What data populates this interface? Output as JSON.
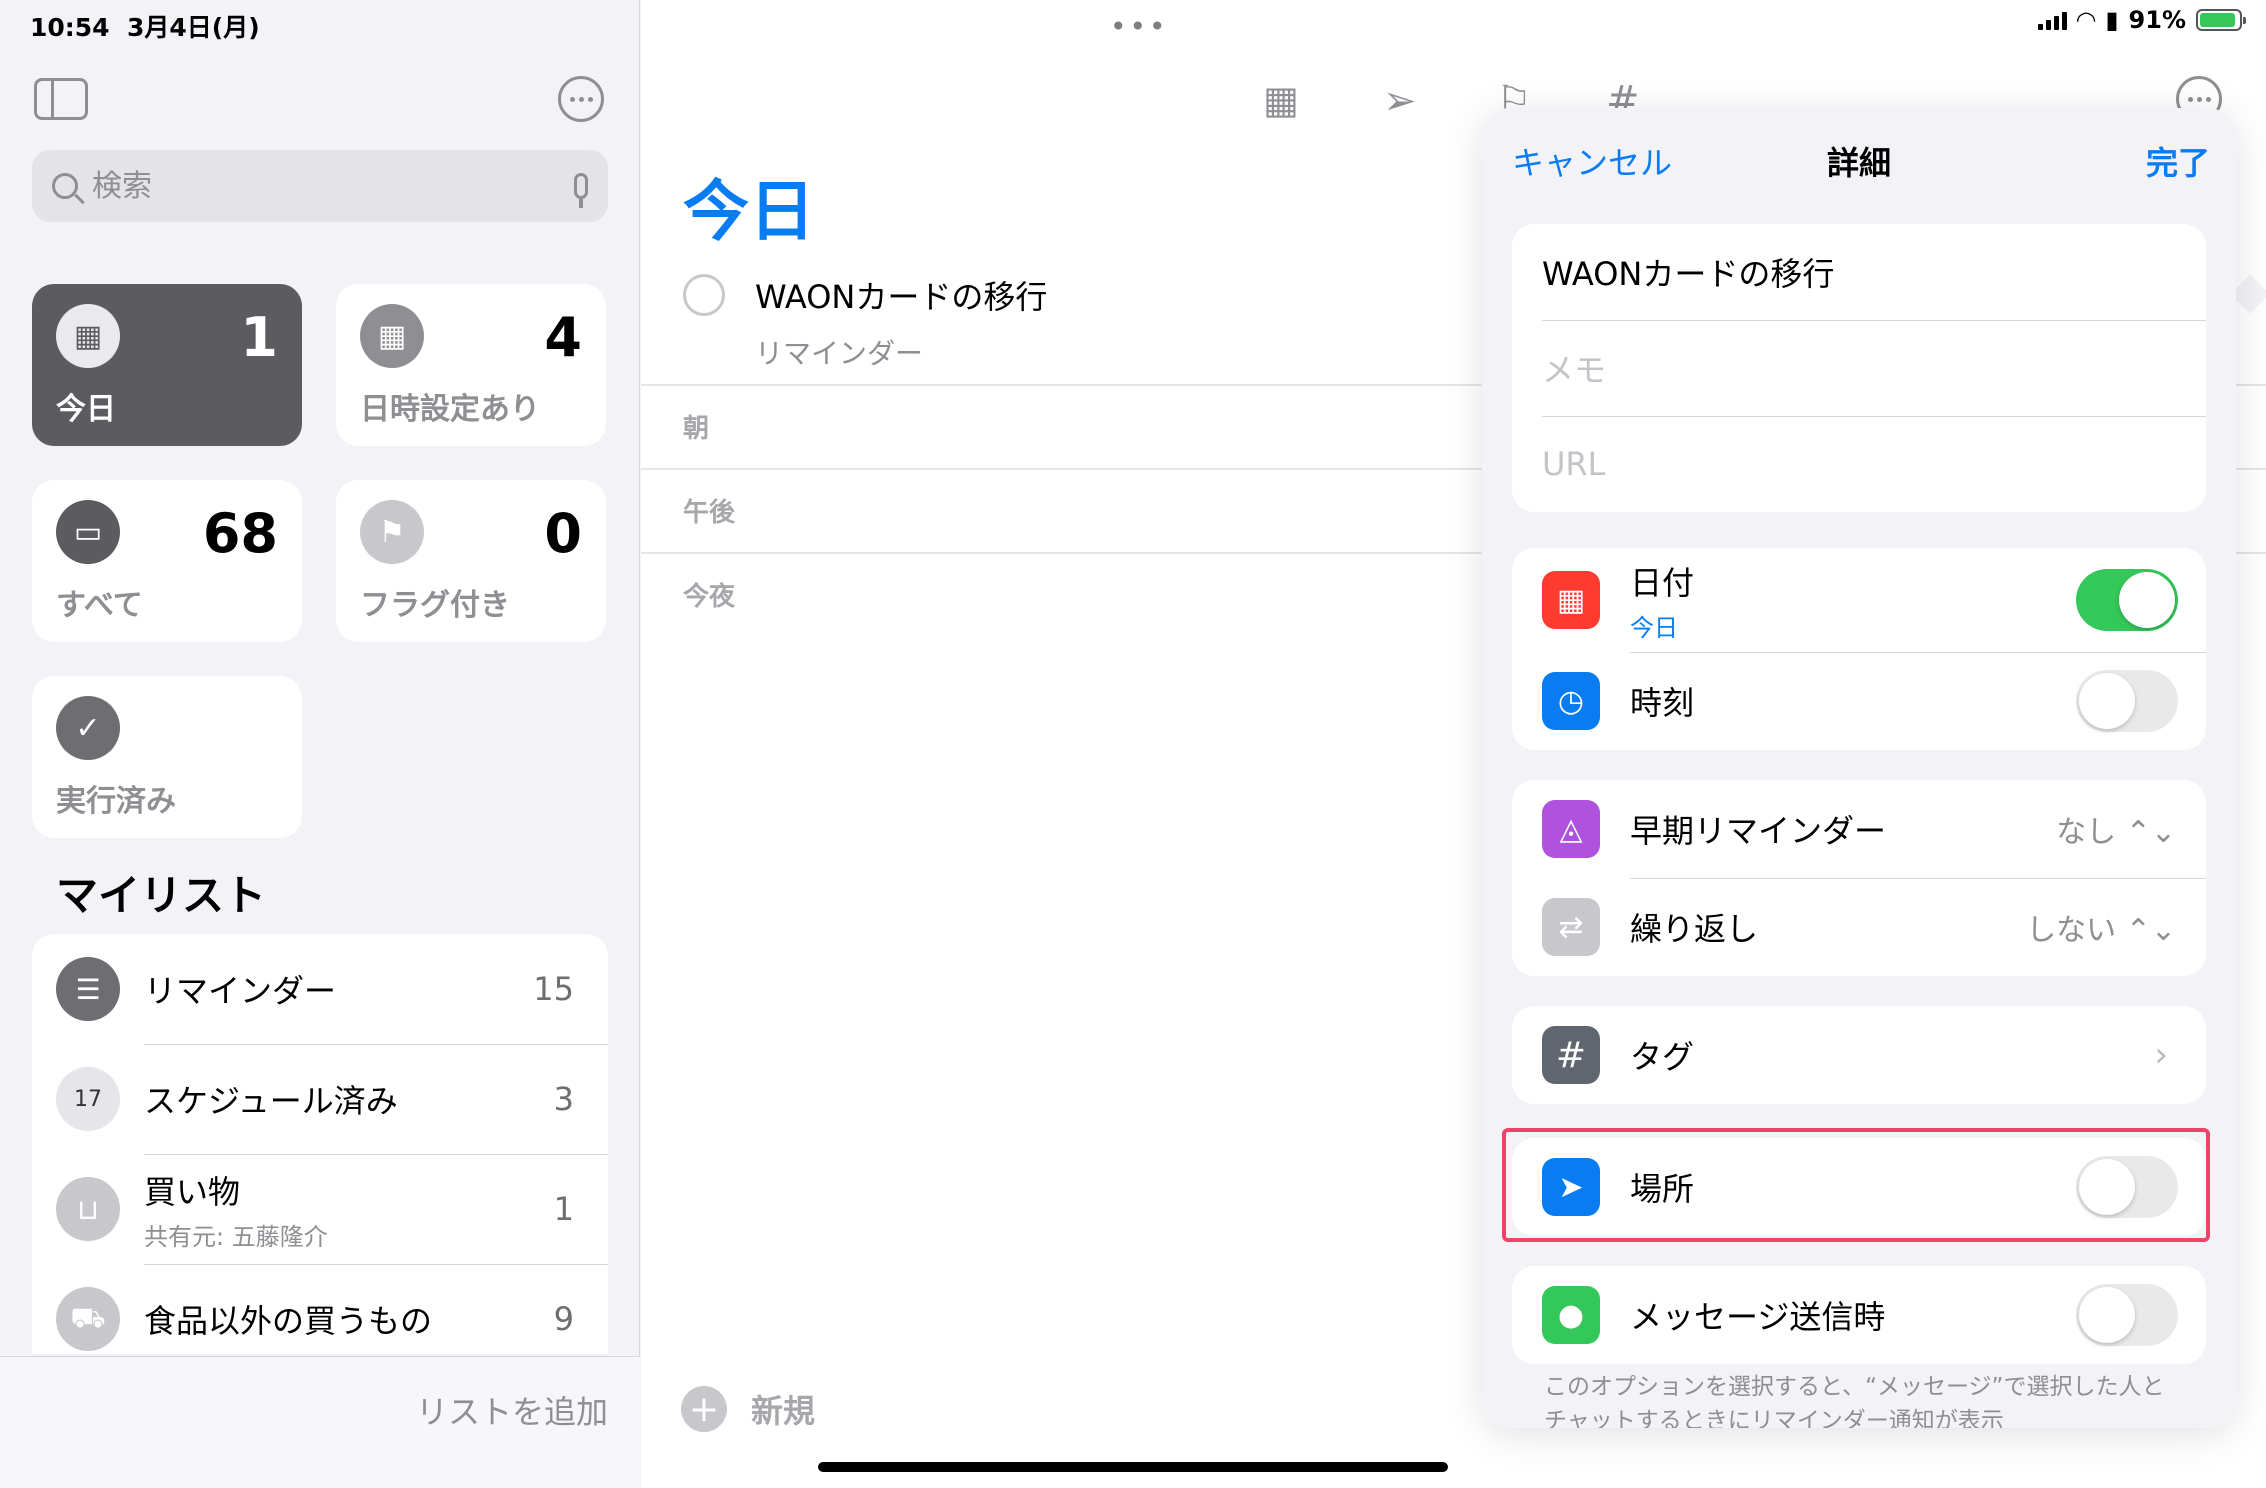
{
  "status_bar": {
    "time": "10:54",
    "date": "3月4日(月)",
    "battery_text": "91%",
    "battery_level": 0.91
  },
  "sidebar": {
    "search_placeholder": "検索",
    "smart_lists": [
      {
        "label": "今日",
        "count": "1",
        "icon": "calendar-today-icon"
      },
      {
        "label": "日時設定あり",
        "count": "4",
        "icon": "calendar-grid-icon"
      },
      {
        "label": "すべて",
        "count": "68",
        "icon": "tray-icon"
      },
      {
        "label": "フラグ付き",
        "count": "0",
        "icon": "flag-icon"
      },
      {
        "label": "実行済み",
        "icon": "checkmark-icon"
      }
    ],
    "my_lists_title": "マイリスト",
    "my_lists": [
      {
        "name": "リマインダー",
        "count": "15",
        "icon": "list-bullet-icon"
      },
      {
        "name": "スケジュール済み",
        "count": "3",
        "icon": "calendar-17-icon",
        "calendar_day": "17"
      },
      {
        "name": "買い物",
        "sub": "共有元: 五藤隆介",
        "count": "1",
        "icon": "basket-icon"
      },
      {
        "name": "食品以外の買うもの",
        "count": "9",
        "icon": "cart-icon"
      }
    ],
    "add_list_label": "リストを追加"
  },
  "main": {
    "title": "今日",
    "reminder": {
      "title": "WAONカードの移行",
      "list": "リマインダー"
    },
    "sections": [
      "朝",
      "午後",
      "今夜"
    ],
    "new_label": "新規"
  },
  "details": {
    "cancel": "キャンセル",
    "title": "詳細",
    "done": "完了",
    "task_title": "WAONカードの移行",
    "notes_placeholder": "メモ",
    "url_placeholder": "URL",
    "date": {
      "label": "日付",
      "sub": "今日",
      "on": true
    },
    "time": {
      "label": "時刻",
      "on": false
    },
    "early_reminder": {
      "label": "早期リマインダー",
      "value": "なし ⌃⌄"
    },
    "repeat": {
      "label": "繰り返し",
      "value": "しない ⌃⌄"
    },
    "tags": {
      "label": "タグ"
    },
    "location": {
      "label": "場所",
      "on": false
    },
    "messaging": {
      "label": "メッセージ送信時",
      "on": false
    },
    "footnote": "このオプションを選択すると、“メッセージ”で選択した人とチャットするときにリマインダー通知が表示"
  },
  "colors": {
    "accent": "#0a7cf2",
    "toggle_on": "#34c759",
    "highlight": "#f0436a"
  }
}
